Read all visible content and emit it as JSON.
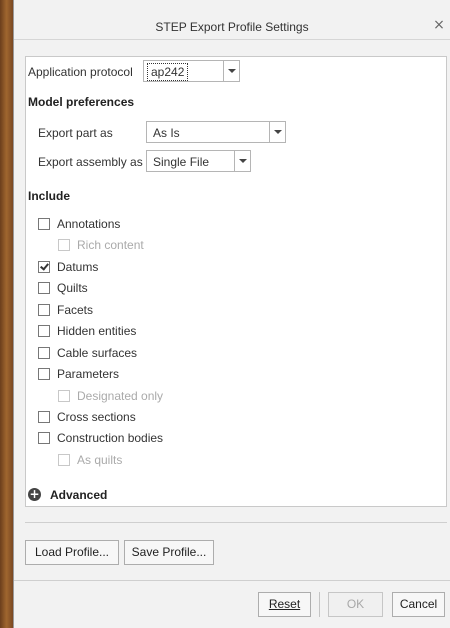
{
  "dialog": {
    "title": "STEP Export Profile Settings",
    "close_glyph": "×"
  },
  "application_protocol": {
    "label": "Application protocol",
    "value": "ap242"
  },
  "model_preferences": {
    "title": "Model preferences",
    "export_part": {
      "label": "Export part as",
      "value": "As Is"
    },
    "export_assembly": {
      "label": "Export assembly as",
      "value": "Single File"
    }
  },
  "include": {
    "title": "Include",
    "items": [
      {
        "label": "Annotations",
        "checked": false,
        "disabled": false
      },
      {
        "label": "Rich content",
        "checked": false,
        "disabled": true
      },
      {
        "label": "Datums",
        "checked": true,
        "disabled": false
      },
      {
        "label": "Quilts",
        "checked": false,
        "disabled": false
      },
      {
        "label": "Facets",
        "checked": false,
        "disabled": false
      },
      {
        "label": "Hidden entities",
        "checked": false,
        "disabled": false
      },
      {
        "label": "Cable surfaces",
        "checked": false,
        "disabled": false
      },
      {
        "label": "Parameters",
        "checked": false,
        "disabled": false
      },
      {
        "label": "Designated only",
        "checked": false,
        "disabled": true
      },
      {
        "label": "Cross sections",
        "checked": false,
        "disabled": false
      },
      {
        "label": "Construction bodies",
        "checked": false,
        "disabled": false
      },
      {
        "label": "As quilts",
        "checked": false,
        "disabled": true
      }
    ]
  },
  "advanced": {
    "label": "Advanced",
    "icon": "plus-circle-icon"
  },
  "profile_buttons": {
    "load": "Load Profile...",
    "save": "Save Profile..."
  },
  "footer_buttons": {
    "reset": "Reset",
    "ok": "OK",
    "cancel": "Cancel"
  }
}
